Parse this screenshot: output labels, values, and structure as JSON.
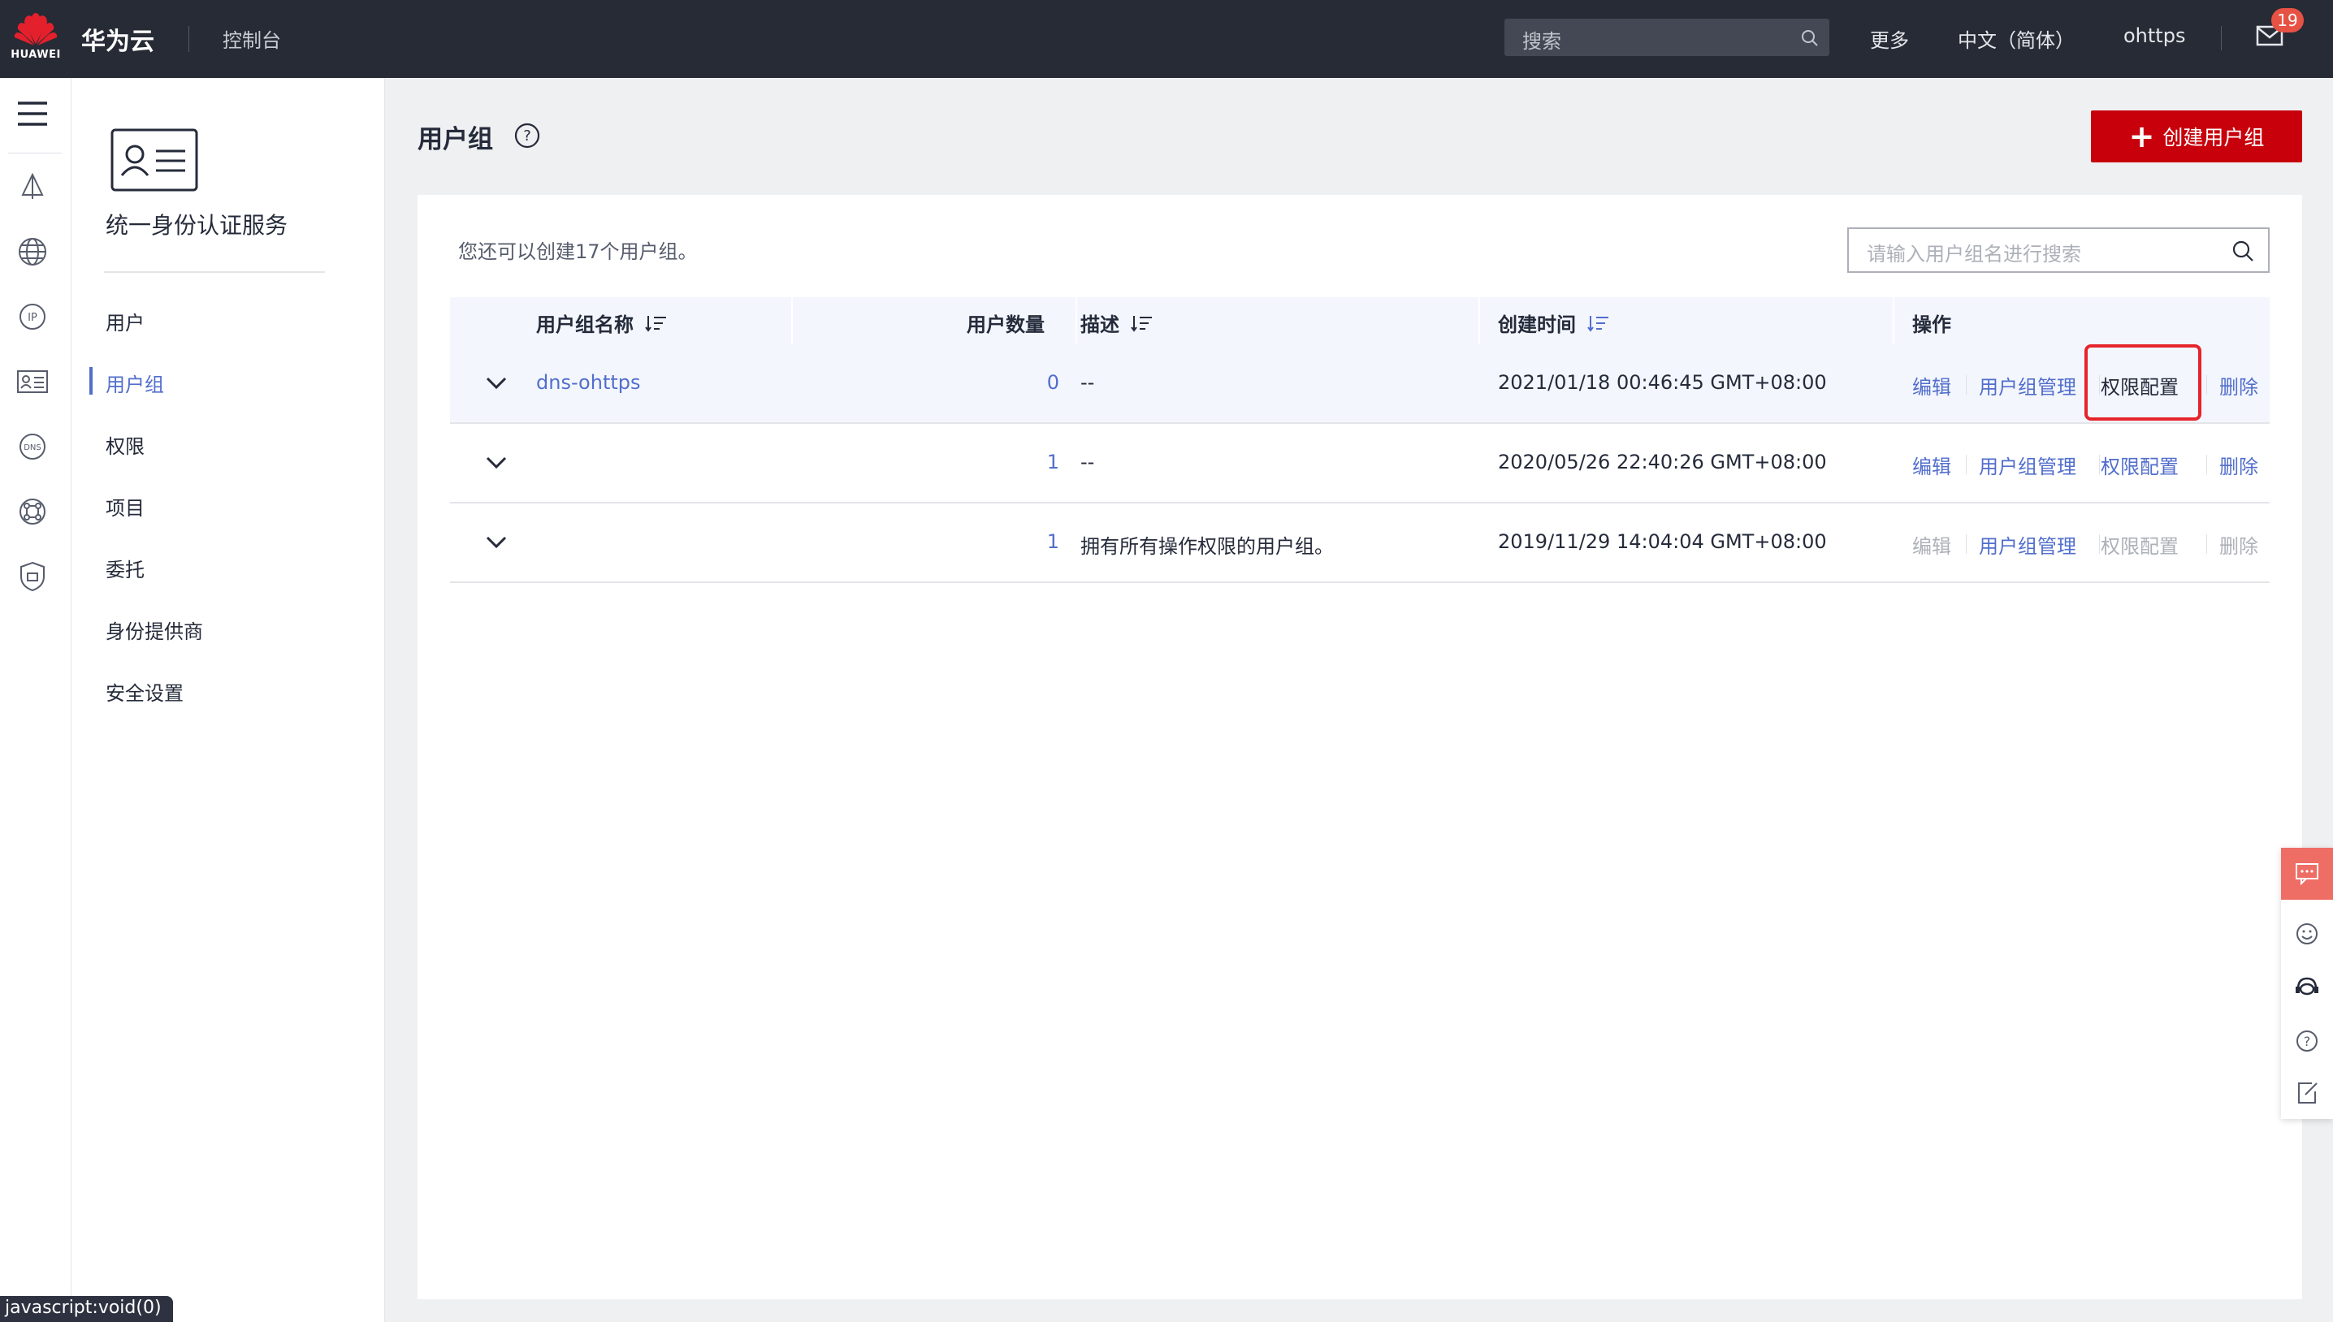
{
  "topbar": {
    "logo_text": "HUAWEI",
    "brand": "华为云",
    "console": "控制台",
    "search_placeholder": "搜索",
    "more": "更多",
    "language": "中文（简体）",
    "username": "ohttps",
    "mail_badge": "19"
  },
  "rail": {
    "icons": [
      "menu-icon",
      "network-icon",
      "globe-icon",
      "ip-icon",
      "id-card-icon",
      "dns-icon",
      "hub-icon",
      "shield-icon"
    ]
  },
  "sidemenu": {
    "service_title": "统一身份认证服务",
    "items": [
      {
        "label": "用户",
        "active": false
      },
      {
        "label": "用户组",
        "active": true
      },
      {
        "label": "权限",
        "active": false
      },
      {
        "label": "项目",
        "active": false
      },
      {
        "label": "委托",
        "active": false
      },
      {
        "label": "身份提供商",
        "active": false
      },
      {
        "label": "安全设置",
        "active": false
      }
    ]
  },
  "main": {
    "title": "用户组",
    "create_button": "创建用户组",
    "quota_text": "您还可以创建17个用户组。",
    "search_placeholder": "请输入用户组名进行搜索",
    "columns": [
      "用户组名称",
      "用户数量",
      "描述",
      "创建时间",
      "操作"
    ],
    "rows": [
      {
        "name": "dns-ohttps",
        "count": "0",
        "desc": "--",
        "created": "2021/01/18 00:46:45 GMT+08:00",
        "ops": [
          "编辑",
          "用户组管理",
          "权限配置",
          "删除"
        ],
        "ops_disabled": [
          false,
          false,
          false,
          false
        ]
      },
      {
        "name": "",
        "count": "1",
        "desc": "--",
        "created": "2020/05/26 22:40:26 GMT+08:00",
        "ops": [
          "编辑",
          "用户组管理",
          "权限配置",
          "删除"
        ],
        "ops_disabled": [
          false,
          false,
          false,
          false
        ]
      },
      {
        "name": "",
        "count": "1",
        "desc": "拥有所有操作权限的用户组。",
        "created": "2019/11/29 14:04:04 GMT+08:00",
        "ops": [
          "编辑",
          "用户组管理",
          "权限配置",
          "删除"
        ],
        "ops_disabled": [
          true,
          false,
          true,
          true
        ]
      }
    ]
  },
  "statusbar": {
    "text": "javascript:void(0)"
  },
  "colors": {
    "topbar": "#272b35",
    "accent": "#c7000b",
    "link": "#526ecc",
    "highlight_box": "#e6242b",
    "float_top": "#ee6e66"
  }
}
